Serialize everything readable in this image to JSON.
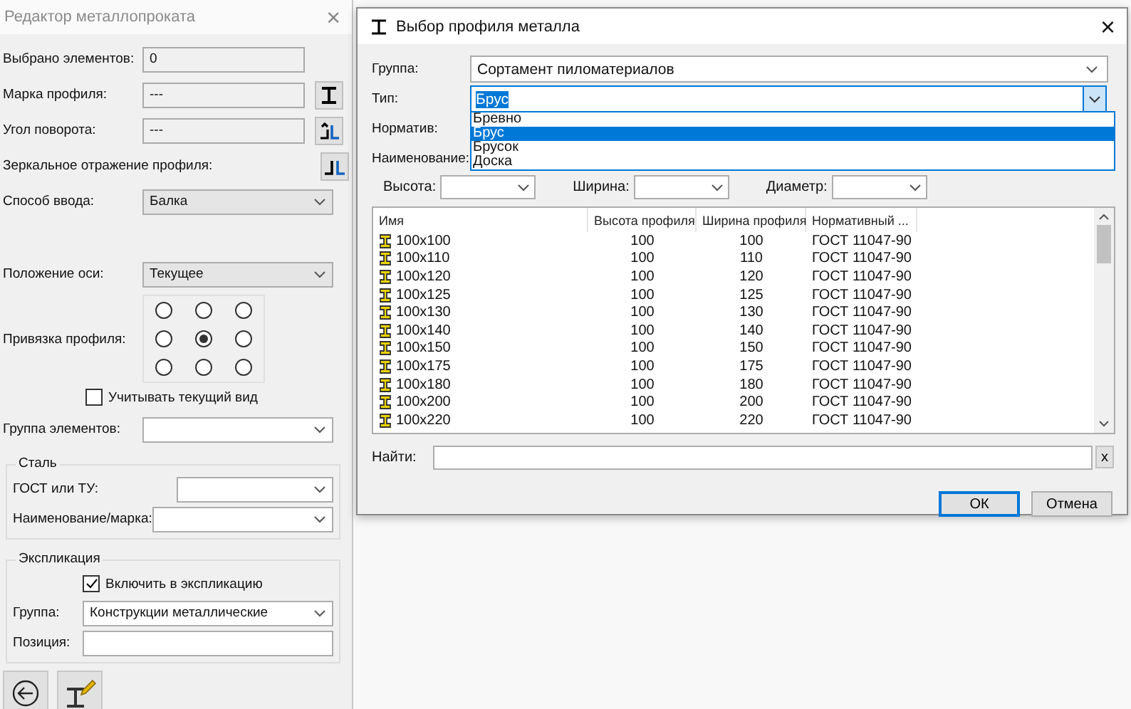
{
  "editor": {
    "title": "Редактор металлопроката",
    "close": "×",
    "selected_count": {
      "label": "Выбрано элементов:",
      "value": "0"
    },
    "profile_mark": {
      "label": "Марка профиля:",
      "value": "---"
    },
    "rotation_angle": {
      "label": "Угол поворота:",
      "value": "---"
    },
    "mirror": {
      "label": "Зеркальное отражение профиля:"
    },
    "input_method": {
      "label": "Способ ввода:",
      "value": "Балка"
    },
    "axis_position": {
      "label": "Положение оси:",
      "value": "Текущее"
    },
    "anchor": {
      "label": "Привязка профиля:",
      "options": [
        {
          "selected": false
        },
        {
          "selected": false
        },
        {
          "selected": false
        },
        {
          "selected": false
        },
        {
          "selected": true
        },
        {
          "selected": false
        },
        {
          "selected": false
        },
        {
          "selected": false
        },
        {
          "selected": false
        }
      ]
    },
    "consider_view": {
      "label": "Учитывать текущий вид",
      "checked": false
    },
    "element_group": {
      "label": "Группа элементов:"
    },
    "steel": {
      "title": "Сталь",
      "fields": [
        {
          "label": "ГОСТ или ТУ:"
        },
        {
          "label": "Наименование/марка:"
        }
      ]
    },
    "explication": {
      "title": "Экспликация",
      "include": {
        "label": "Включить в экспликацию",
        "checked": true
      },
      "group": {
        "label": "Группа:",
        "value": "Конструкции металлические"
      },
      "position": {
        "label": "Позиция:"
      }
    }
  },
  "dialog": {
    "title": "Выбор профиля металла",
    "close": "×",
    "group": {
      "label": "Группа:",
      "value": "Сортамент пиломатериалов"
    },
    "type": {
      "label": "Тип:",
      "value": "Брус",
      "expanded": true,
      "options": [
        {
          "label": "Бревно",
          "selected": false
        },
        {
          "label": "Брус",
          "selected": true
        },
        {
          "label": "Брусок",
          "selected": false
        },
        {
          "label": "Доска",
          "selected": false
        }
      ]
    },
    "normative": {
      "label": "Норматив:"
    },
    "name": {
      "label": "Наименование:"
    },
    "filters": [
      {
        "label": "Высота:"
      },
      {
        "label": "Ширина:"
      },
      {
        "label": "Диаметр:"
      }
    ],
    "table": {
      "columns": [
        "Имя",
        "Высота профиля",
        "Ширина профиля",
        "Нормативный ..."
      ],
      "rows": [
        [
          "100x100",
          "100",
          "100",
          "ГОСТ 11047-90"
        ],
        [
          "100x110",
          "100",
          "110",
          "ГОСТ 11047-90"
        ],
        [
          "100x120",
          "100",
          "120",
          "ГОСТ 11047-90"
        ],
        [
          "100x125",
          "100",
          "125",
          "ГОСТ 11047-90"
        ],
        [
          "100x130",
          "100",
          "130",
          "ГОСТ 11047-90"
        ],
        [
          "100x140",
          "100",
          "140",
          "ГОСТ 11047-90"
        ],
        [
          "100x150",
          "100",
          "150",
          "ГОСТ 11047-90"
        ],
        [
          "100x175",
          "100",
          "175",
          "ГОСТ 11047-90"
        ],
        [
          "100x180",
          "100",
          "180",
          "ГОСТ 11047-90"
        ],
        [
          "100x200",
          "100",
          "200",
          "ГОСТ 11047-90"
        ],
        [
          "100x220",
          "100",
          "220",
          "ГОСТ 11047-90"
        ]
      ]
    },
    "find": {
      "label": "Найти:",
      "clear": "x"
    },
    "buttons": [
      {
        "label": "ОК",
        "default": true
      },
      {
        "label": "Отмена",
        "default": false
      }
    ]
  }
}
